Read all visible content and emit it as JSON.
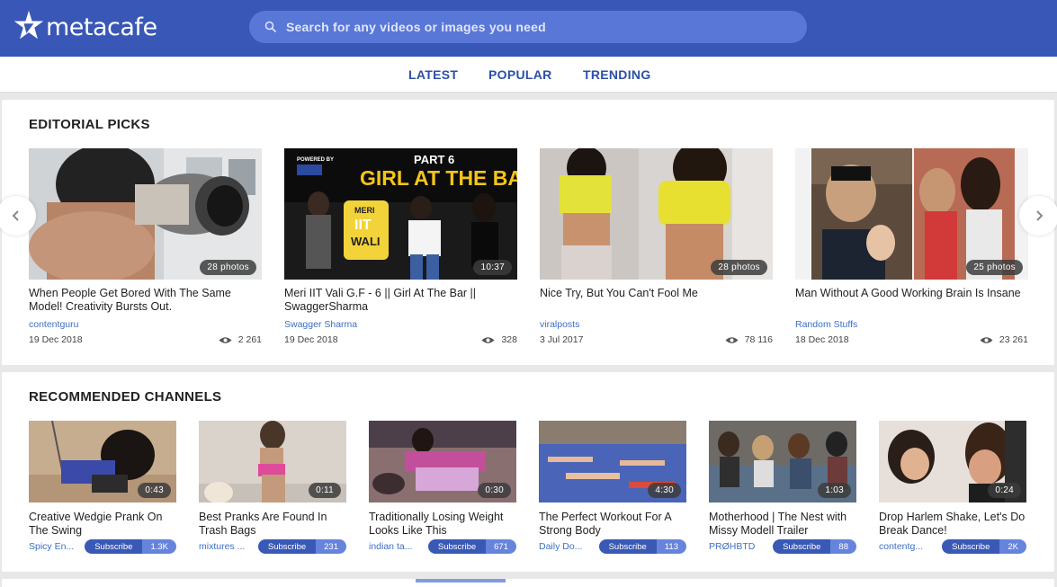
{
  "brand": {
    "name": "metacafe",
    "colors": {
      "header": "#3957b7",
      "search_bg": "#5977d6",
      "nav_text": "#2d4fa6",
      "link": "#3b6fc6"
    }
  },
  "search": {
    "placeholder": "Search for any videos or images you need",
    "icon": "search-icon"
  },
  "nav": {
    "items": [
      "LATEST",
      "POPULAR",
      "TRENDING"
    ]
  },
  "editorial": {
    "title": "EDITORIAL PICKS",
    "cards": [
      {
        "badge": "28 photos",
        "title": "When People Get Bored With The Same Model! Creativity Bursts Out.",
        "channel": "contentguru",
        "date": "19 Dec 2018",
        "views": "2 261"
      },
      {
        "badge": "10:37",
        "title": "Meri IIT Vali G.F - 6 || Girl At The Bar || SwaggerSharma",
        "channel": "Swagger Sharma",
        "date": "19 Dec 2018",
        "views": "328",
        "thumb_text": {
          "powered": "POWERED BY",
          "part": "PART 6",
          "headline": "GIRL AT THE BAR",
          "sign_line1": "MERI",
          "sign_line2": "IIT",
          "sign_line3": "WALI"
        }
      },
      {
        "badge": "28 photos",
        "title": "Nice Try, But You Can't Fool Me",
        "channel": "viralposts",
        "date": "3 Jul 2017",
        "views": "78 116"
      },
      {
        "badge": "25 photos",
        "title": "Man Without A Good Working Brain Is Insane",
        "channel": "Random Stuffs",
        "date": "18 Dec 2018",
        "views": "23 261"
      }
    ]
  },
  "channels": {
    "title": "RECOMMENDED CHANNELS",
    "subscribe_label": "Subscribe",
    "cards": [
      {
        "duration": "0:43",
        "title": "Creative Wedgie Prank On The Swing",
        "channel": "Spicy En...",
        "count": "1.3K"
      },
      {
        "duration": "0:11",
        "title": "Best Pranks Are Found In Trash Bags",
        "channel": "mixtures ...",
        "count": "231"
      },
      {
        "duration": "0:30",
        "title": "Traditionally Losing Weight Looks Like This",
        "channel": "indian ta...",
        "count": "671"
      },
      {
        "duration": "4:30",
        "title": "The Perfect Workout For A Strong Body",
        "channel": "Daily Do...",
        "count": "113"
      },
      {
        "duration": "1:03",
        "title": "Motherhood | The Nest with Missy Modell Trailer",
        "channel": "PRØHBTD",
        "count": "88"
      },
      {
        "duration": "0:24",
        "title": "Drop Harlem Shake, Let's Do Break Dance!",
        "channel": "contentg...",
        "count": "2K"
      }
    ]
  }
}
